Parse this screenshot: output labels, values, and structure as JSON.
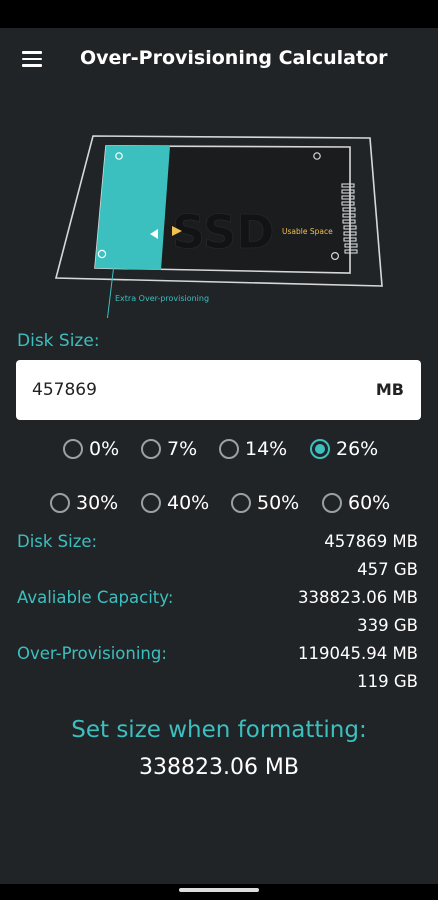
{
  "app": {
    "title": "Over-Provisioning Calculator"
  },
  "illustration": {
    "ssd_text": "SSD",
    "usable_label": "Usable Space",
    "extra_label": "Extra Over-provisioning",
    "colors": {
      "accent": "#3cbfbf",
      "arrow": "#f2c14e",
      "outline": "#d8d8d8"
    }
  },
  "disk": {
    "label": "Disk Size:",
    "value": "457869",
    "unit": "MB"
  },
  "percent_options": [
    {
      "label": "0%",
      "checked": false
    },
    {
      "label": "7%",
      "checked": false
    },
    {
      "label": "14%",
      "checked": false
    },
    {
      "label": "26%",
      "checked": true
    },
    {
      "label": "30%",
      "checked": false
    },
    {
      "label": "40%",
      "checked": false
    },
    {
      "label": "50%",
      "checked": false
    },
    {
      "label": "60%",
      "checked": false
    }
  ],
  "results": {
    "disk_size": {
      "label": "Disk Size:",
      "mb": "457869 MB",
      "gb": "457 GB"
    },
    "available": {
      "label": "Avaliable Capacity:",
      "mb": "338823.06 MB",
      "gb": "339 GB"
    },
    "op": {
      "label": "Over-Provisioning:",
      "mb": "119045.94 MB",
      "gb": "119 GB"
    }
  },
  "format": {
    "title": "Set size when formatting:",
    "value": "338823.06 MB"
  },
  "theme": {
    "background": "#212427",
    "accent": "#3cbfbf",
    "input_bg": "#ffffff"
  }
}
